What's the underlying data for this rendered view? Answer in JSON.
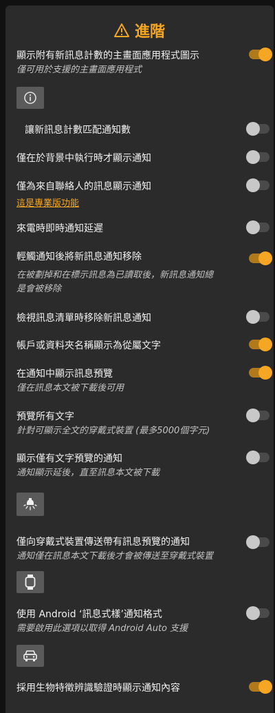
{
  "header": {
    "title": "進階",
    "icon": "warning-icon",
    "accent": "#f5a623"
  },
  "settings": [
    {
      "label": "顯示附有新訊息計數的主畫面應用程式圖示",
      "sub": "僅可用於支援的主畫面應用程式",
      "on": true,
      "button_icon": "info-icon"
    },
    {
      "label": "讓新訊息計數匹配通知數",
      "on": false
    },
    {
      "label": "僅在於背景中執行時才顯示通知",
      "on": false
    },
    {
      "label": "僅為來自聯絡人的訊息顯示通知",
      "link": "這是專業版功能",
      "on": false
    },
    {
      "label": "來電時即時通知延遲",
      "on": false
    },
    {
      "label": "輕觸通知後將新訊息通知移除",
      "sub1": "在被劃掉和在標示訊息為已讀取後，新訊息通知總",
      "sub2": "是會被移除",
      "on": true
    },
    {
      "label": "檢視訊息清單時移除新訊息通知",
      "on": false
    },
    {
      "label": "帳戶或資料夾名稱顯示為從屬文字",
      "on": true
    },
    {
      "label": "在通知中顯示訊息預覽",
      "sub": "僅在訊息本文被下載後可用",
      "on": true
    },
    {
      "label": "預覽所有文字",
      "sub": "針對可顯示全文的穿戴式裝置 (最多5000個字元)",
      "on": false
    },
    {
      "label": "顯示僅有文字預覽的通知",
      "sub": "通知顯示延後，直至訊息本文被下載",
      "on": false,
      "button_icon": "light-bulb-icon"
    },
    {
      "label": "僅向穿戴式裝置傳送帶有訊息預覽的通知",
      "sub": "通知僅在訊息本文下載後才會被傳送至穿戴式裝置",
      "on": false,
      "button_icon": "watch-icon"
    },
    {
      "label": "使用 Android ‘訊息式樣’通知格式",
      "sub": "需要啟用此選項以取得 Android Auto 支援",
      "on": false,
      "button_icon": "car-icon"
    },
    {
      "label": "採用生物特徵辨識驗證時顯示通知內容",
      "on": true
    }
  ]
}
